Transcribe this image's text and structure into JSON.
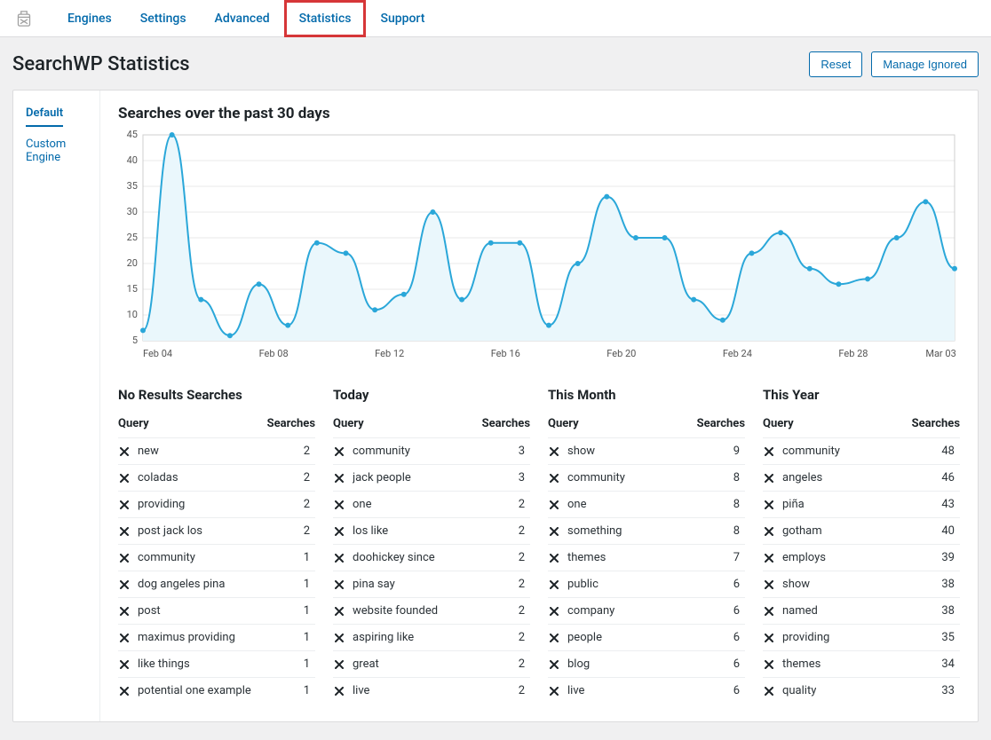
{
  "nav": {
    "items": [
      {
        "label": "Engines",
        "highlight": false
      },
      {
        "label": "Settings",
        "highlight": false
      },
      {
        "label": "Advanced",
        "highlight": false
      },
      {
        "label": "Statistics",
        "highlight": true
      },
      {
        "label": "Support",
        "highlight": false
      }
    ]
  },
  "header": {
    "title": "SearchWP Statistics",
    "reset_label": "Reset",
    "manage_ignored_label": "Manage Ignored"
  },
  "sidebar": {
    "items": [
      {
        "label": "Default",
        "active": true
      },
      {
        "label": "Custom Engine",
        "active": false
      }
    ]
  },
  "chart_title": "Searches over the past 30 days",
  "chart_data": {
    "type": "line",
    "title": "Searches over the past 30 days",
    "xlabel": "",
    "ylabel": "",
    "ylim": [
      5,
      45
    ],
    "y_ticks": [
      5,
      10,
      15,
      20,
      25,
      30,
      35,
      40,
      45
    ],
    "x_tick_labels": [
      "Feb 04",
      "Feb 08",
      "Feb 12",
      "Feb 16",
      "Feb 20",
      "Feb 24",
      "Feb 28",
      "Mar 03"
    ],
    "x_tick_indices": [
      0,
      4,
      8,
      12,
      16,
      20,
      24,
      27
    ],
    "values": [
      7,
      45,
      13,
      6,
      16,
      8,
      24,
      22,
      11,
      14,
      30,
      13,
      24,
      24,
      8,
      20,
      33,
      25,
      25,
      13,
      9,
      22,
      26,
      19,
      16,
      17,
      25,
      32,
      19
    ]
  },
  "columns": {
    "query": "Query",
    "searches": "Searches"
  },
  "sections": [
    {
      "title": "No Results Searches",
      "rows": [
        {
          "q": "new",
          "n": 2
        },
        {
          "q": "coladas",
          "n": 2
        },
        {
          "q": "providing",
          "n": 2
        },
        {
          "q": "post jack los",
          "n": 2
        },
        {
          "q": "community",
          "n": 1
        },
        {
          "q": "dog angeles pina",
          "n": 1
        },
        {
          "q": "post",
          "n": 1
        },
        {
          "q": "maximus providing",
          "n": 1
        },
        {
          "q": "like things",
          "n": 1
        },
        {
          "q": "potential one example",
          "n": 1
        }
      ]
    },
    {
      "title": "Today",
      "rows": [
        {
          "q": "community",
          "n": 3
        },
        {
          "q": "jack people",
          "n": 3
        },
        {
          "q": "one",
          "n": 2
        },
        {
          "q": "los like",
          "n": 2
        },
        {
          "q": "doohickey since",
          "n": 2
        },
        {
          "q": "pina say",
          "n": 2
        },
        {
          "q": "website founded",
          "n": 2
        },
        {
          "q": "aspiring like",
          "n": 2
        },
        {
          "q": "great",
          "n": 2
        },
        {
          "q": "live",
          "n": 2
        }
      ]
    },
    {
      "title": "This Month",
      "rows": [
        {
          "q": "show",
          "n": 9
        },
        {
          "q": "community",
          "n": 8
        },
        {
          "q": "one",
          "n": 8
        },
        {
          "q": "something",
          "n": 8
        },
        {
          "q": "themes",
          "n": 7
        },
        {
          "q": "public",
          "n": 6
        },
        {
          "q": "company",
          "n": 6
        },
        {
          "q": "people",
          "n": 6
        },
        {
          "q": "blog",
          "n": 6
        },
        {
          "q": "live",
          "n": 6
        }
      ]
    },
    {
      "title": "This Year",
      "rows": [
        {
          "q": "community",
          "n": 48
        },
        {
          "q": "angeles",
          "n": 46
        },
        {
          "q": "piña",
          "n": 43
        },
        {
          "q": "gotham",
          "n": 40
        },
        {
          "q": "employs",
          "n": 39
        },
        {
          "q": "show",
          "n": 38
        },
        {
          "q": "named",
          "n": 38
        },
        {
          "q": "providing",
          "n": 35
        },
        {
          "q": "themes",
          "n": 34
        },
        {
          "q": "quality",
          "n": 33
        }
      ]
    }
  ]
}
